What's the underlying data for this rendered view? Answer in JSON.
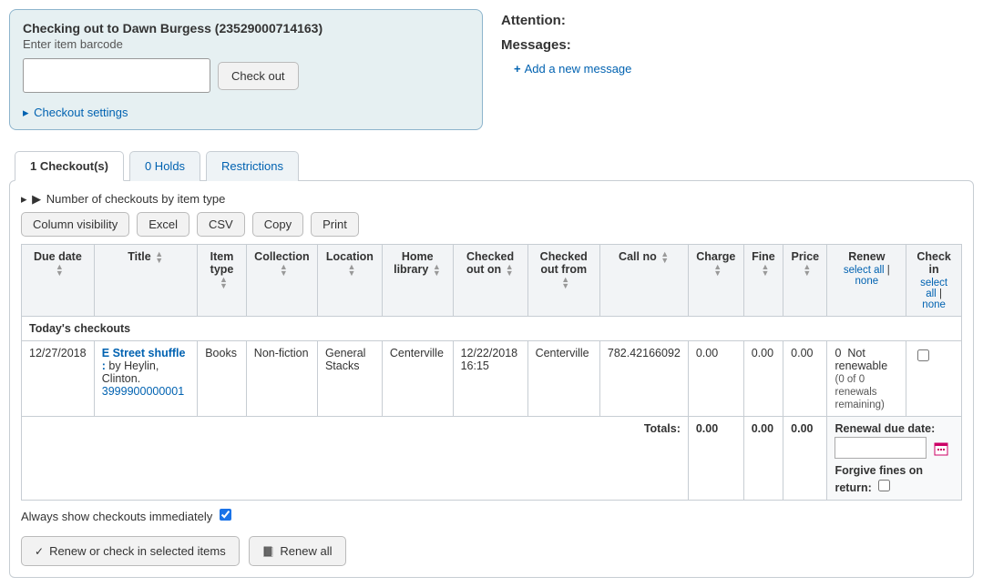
{
  "checkout_panel": {
    "title": "Checking out to Dawn Burgess (23529000714163)",
    "subtitle": "Enter item barcode",
    "button_label": "Check out",
    "settings_label": "Checkout settings"
  },
  "right": {
    "attention_label": "Attention:",
    "messages_label": "Messages:",
    "add_message_label": "Add a new message"
  },
  "tabs": {
    "checkouts": "1 Checkout(s)",
    "holds": "0 Holds",
    "restrictions": "Restrictions"
  },
  "itemtype_line": "Number of checkouts by item type",
  "toolbar": {
    "colvis": "Column visibility",
    "excel": "Excel",
    "csv": "CSV",
    "copy": "Copy",
    "print": "Print"
  },
  "headers": {
    "due": "Due date",
    "title": "Title",
    "itemtype": "Item type",
    "collection": "Collection",
    "location": "Location",
    "home": "Home library",
    "out_on": "Checked out on",
    "out_from": "Checked out from",
    "callno": "Call no",
    "charge": "Charge",
    "fine": "Fine",
    "price": "Price",
    "renew": "Renew",
    "checkin": "Check in",
    "select_all": "select all",
    "none": "none"
  },
  "section_label": "Today's checkouts",
  "row": {
    "due": "12/27/2018",
    "title_link": "E Street shuffle :",
    "byline": " by Heylin, Clinton.",
    "barcode": "3999900000001",
    "itemtype": "Books",
    "collection": "Non-fiction",
    "location": "General Stacks",
    "home": "Centerville",
    "out_on": "12/22/2018 16:15",
    "out_from": "Centerville",
    "callno": "782.42166092",
    "charge": "0.00",
    "fine": "0.00",
    "price": "0.00",
    "renew_count": "0",
    "renew_label": "Not renewable",
    "renew_note": "(0 of 0 renewals remaining)"
  },
  "totals": {
    "label": "Totals:",
    "charge": "0.00",
    "fine": "0.00",
    "price": "0.00"
  },
  "renewal_box": {
    "due_label": "Renewal due date:",
    "forgive_label": "Forgive fines on return:"
  },
  "always_show_label": "Always show checkouts immediately",
  "bottom": {
    "renew_selected": "Renew or check in selected items",
    "renew_all": "Renew all"
  }
}
